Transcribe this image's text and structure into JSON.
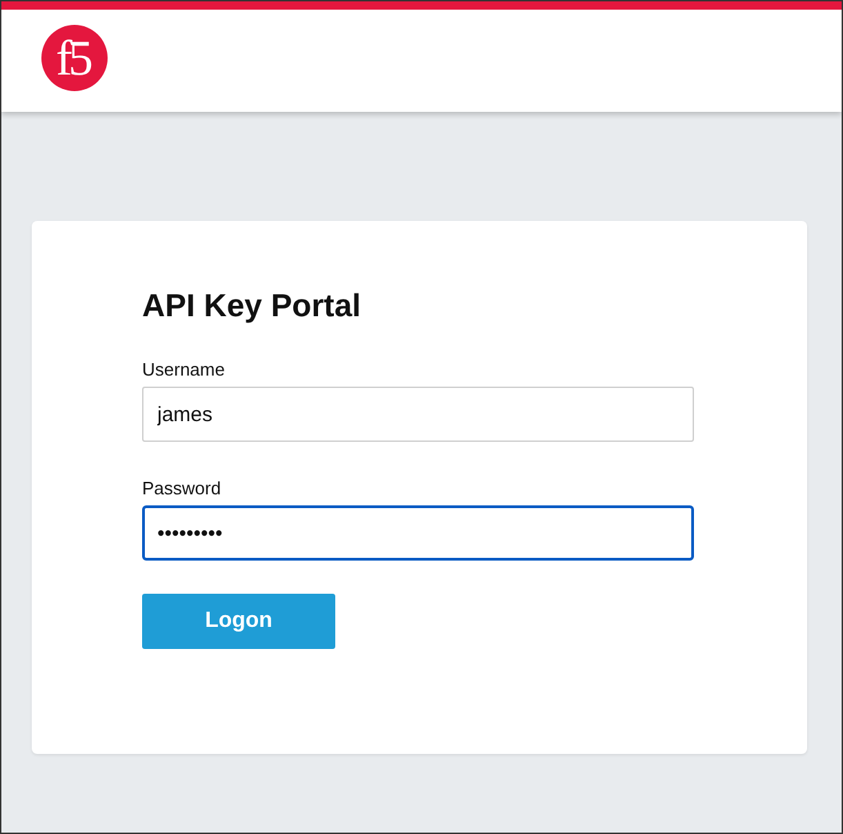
{
  "header": {
    "logo": "f5"
  },
  "login": {
    "title": "API Key Portal",
    "fields": [
      {
        "label": "Username",
        "value": "james",
        "focused": false
      },
      {
        "label": "Password",
        "value": "•••••••••",
        "focused": true
      }
    ],
    "button": "Logon"
  }
}
